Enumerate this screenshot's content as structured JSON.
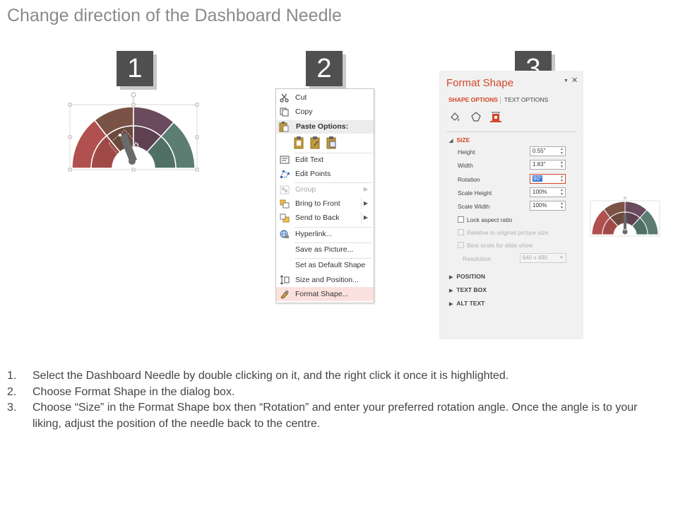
{
  "title": "Change direction of the Dashboard Needle",
  "steps": [
    {
      "label": "1"
    },
    {
      "label": "2"
    },
    {
      "label": "3"
    }
  ],
  "context_menu": {
    "items": [
      {
        "label": "Cut",
        "icon": "scissors-icon",
        "enabled": true
      },
      {
        "label": "Copy",
        "icon": "copy-icon",
        "enabled": true
      },
      {
        "label": "Paste Options:",
        "icon": "paste-icon",
        "enabled": true,
        "header": true
      },
      {
        "label": "Edit Text",
        "icon": "edit-text-icon",
        "enabled": true
      },
      {
        "label": "Edit Points",
        "icon": "edit-points-icon",
        "enabled": true
      },
      {
        "label": "Group",
        "icon": "group-icon",
        "enabled": false,
        "submenu": true
      },
      {
        "label": "Bring to Front",
        "icon": "bring-to-front-icon",
        "enabled": true,
        "submenu": true
      },
      {
        "label": "Send to Back",
        "icon": "send-to-back-icon",
        "enabled": true,
        "submenu": true
      },
      {
        "label": "Hyperlink...",
        "icon": "hyperlink-icon",
        "enabled": true
      },
      {
        "label": "Save as Picture...",
        "icon": "",
        "enabled": true
      },
      {
        "label": "Set as Default Shape",
        "icon": "",
        "enabled": true
      },
      {
        "label": "Size and Position...",
        "icon": "size-position-icon",
        "enabled": true
      },
      {
        "label": "Format Shape...",
        "icon": "format-shape-icon",
        "enabled": true,
        "highlighted": true
      }
    ]
  },
  "format_pane": {
    "title": "Format Shape",
    "tabs": {
      "shape_options": "SHAPE OPTIONS",
      "text_options": "TEXT OPTIONS"
    },
    "sections": {
      "size": "SIZE",
      "position": "POSITION",
      "text_box": "TEXT BOX",
      "alt_text": "ALT TEXT"
    },
    "fields": [
      {
        "label": "Height",
        "value": "0.55\""
      },
      {
        "label": "Width",
        "value": "1.83\""
      },
      {
        "label": "Rotation",
        "value": "90°"
      },
      {
        "label": "Scale Height",
        "value": "100%"
      },
      {
        "label": "Scale Width",
        "value": "100%"
      }
    ],
    "checkboxes": [
      {
        "label": "Lock aspect ratio",
        "enabled": true,
        "checked": false
      },
      {
        "label": "Relative to original picture size",
        "enabled": false,
        "checked": false
      },
      {
        "label": "Best scale for slide show",
        "enabled": false,
        "checked": false
      }
    ],
    "resolution": {
      "label": "Resolution",
      "value": "640 x 480"
    }
  },
  "instructions": [
    {
      "num": "1.",
      "text": "Select the Dashboard Needle by double clicking on it, and the right click it once it is highlighted."
    },
    {
      "num": "2.",
      "text": "Choose Format Shape in the dialog box."
    },
    {
      "num": "3.",
      "text": "Choose “Size” in the Format Shape box then “Rotation” and enter your preferred rotation angle. Once the angle is to your liking, adjust the position of the needle back to the centre."
    }
  ],
  "colors": {
    "gauge_red": "#b0514f",
    "gauge_brown": "#7a5346",
    "gauge_purple": "#6a4a5c",
    "gauge_teal": "#5b7d72",
    "accent": "#d24726"
  }
}
